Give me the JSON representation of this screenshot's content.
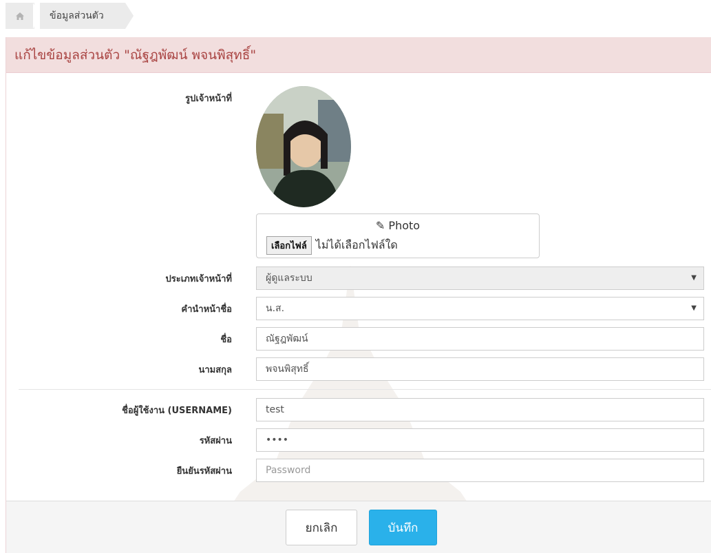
{
  "breadcrumb": {
    "home_icon": "home-icon",
    "current": "ข้อมูลส่วนตัว"
  },
  "panel": {
    "title": "แก้ไขข้อมูลส่วนตัว \"ณัฐฎพัฒน์ พจนพิสุทธิ์\""
  },
  "form": {
    "photo_label": "รูปเจ้าหน้าที่",
    "photo_box_title": "✎ Photo",
    "file_button": "เลือกไฟล์",
    "file_status": "ไม่ได้เลือกไฟล์ใด",
    "staff_type_label": "ประเภทเจ้าหน้าที่",
    "staff_type_value": "ผู้ดูแลระบบ",
    "prefix_label": "คำนำหน้าชื่อ",
    "prefix_value": "น.ส.",
    "firstname_label": "ชื่อ",
    "firstname_value": "ณัฐฎพัฒน์",
    "lastname_label": "นามสกุล",
    "lastname_value": "พจนพิสุทธิ์",
    "username_label": "ชื่อผู้ใช้งาน (USERNAME)",
    "username_value": "test",
    "password_label": "รหัสผ่าน",
    "password_value": "••••",
    "confirm_label": "ยืนยันรหัสผ่าน",
    "confirm_placeholder": "Password"
  },
  "footer": {
    "cancel_label": "ยกเลิก",
    "save_label": "บันทึก"
  },
  "colors": {
    "heading_bg": "#f2dede",
    "heading_text": "#a94442",
    "save_button": "#2ab1ea"
  }
}
